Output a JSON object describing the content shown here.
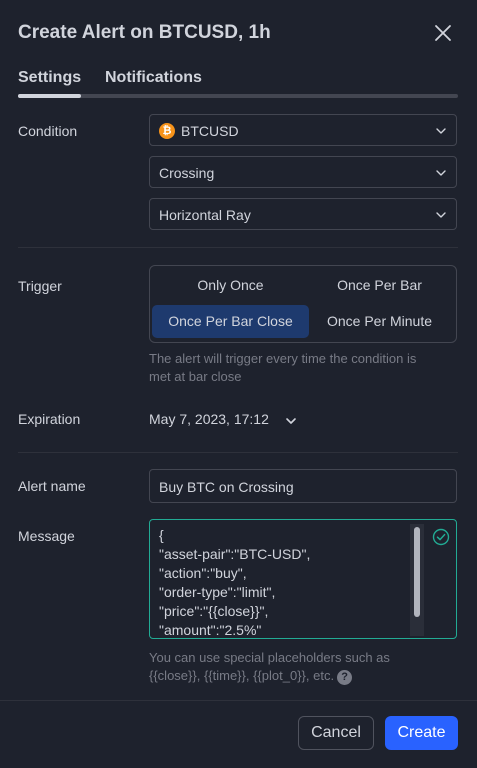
{
  "dialog": {
    "title": "Create Alert on BTCUSD, 1h",
    "close_icon": "close-icon"
  },
  "tabs": [
    {
      "label": "Settings",
      "active": true
    },
    {
      "label": "Notifications",
      "active": false
    }
  ],
  "condition": {
    "label": "Condition",
    "symbol": "BTCUSD",
    "symbol_icon_glyph": "₿",
    "symbol_icon_color": "#f7931a",
    "operator": "Crossing",
    "target": "Horizontal Ray"
  },
  "trigger": {
    "label": "Trigger",
    "options": [
      "Only Once",
      "Once Per Bar",
      "Once Per Bar Close",
      "Once Per Minute"
    ],
    "selected": "Once Per Bar Close",
    "hint_line1": "The alert will trigger every time the condition is",
    "hint_line2": "met at bar close"
  },
  "expiration": {
    "label": "Expiration",
    "value": "May 7, 2023, 17:12"
  },
  "alert_name": {
    "label": "Alert name",
    "value": "Buy BTC on Crossing"
  },
  "message": {
    "label": "Message",
    "lines": [
      "{",
      "\"asset-pair\":\"BTC-USD\",",
      "\"action\":\"buy\",",
      "\"order-type\":\"limit\",",
      "\"price\":\"{{close}}\",",
      "\"amount\":\"2.5%\""
    ],
    "valid_color": "#22ab94",
    "hint_line1": "You can use special placeholders such as",
    "hint_line2": "{{close}}, {{time}}, {{plot_0}}, etc.",
    "help_glyph": "?"
  },
  "footer": {
    "cancel_label": "Cancel",
    "create_label": "Create"
  },
  "colors": {
    "background": "#1e222d",
    "accent": "#2962ff",
    "selected_option": "#1e3a6e",
    "valid": "#22ab94"
  }
}
